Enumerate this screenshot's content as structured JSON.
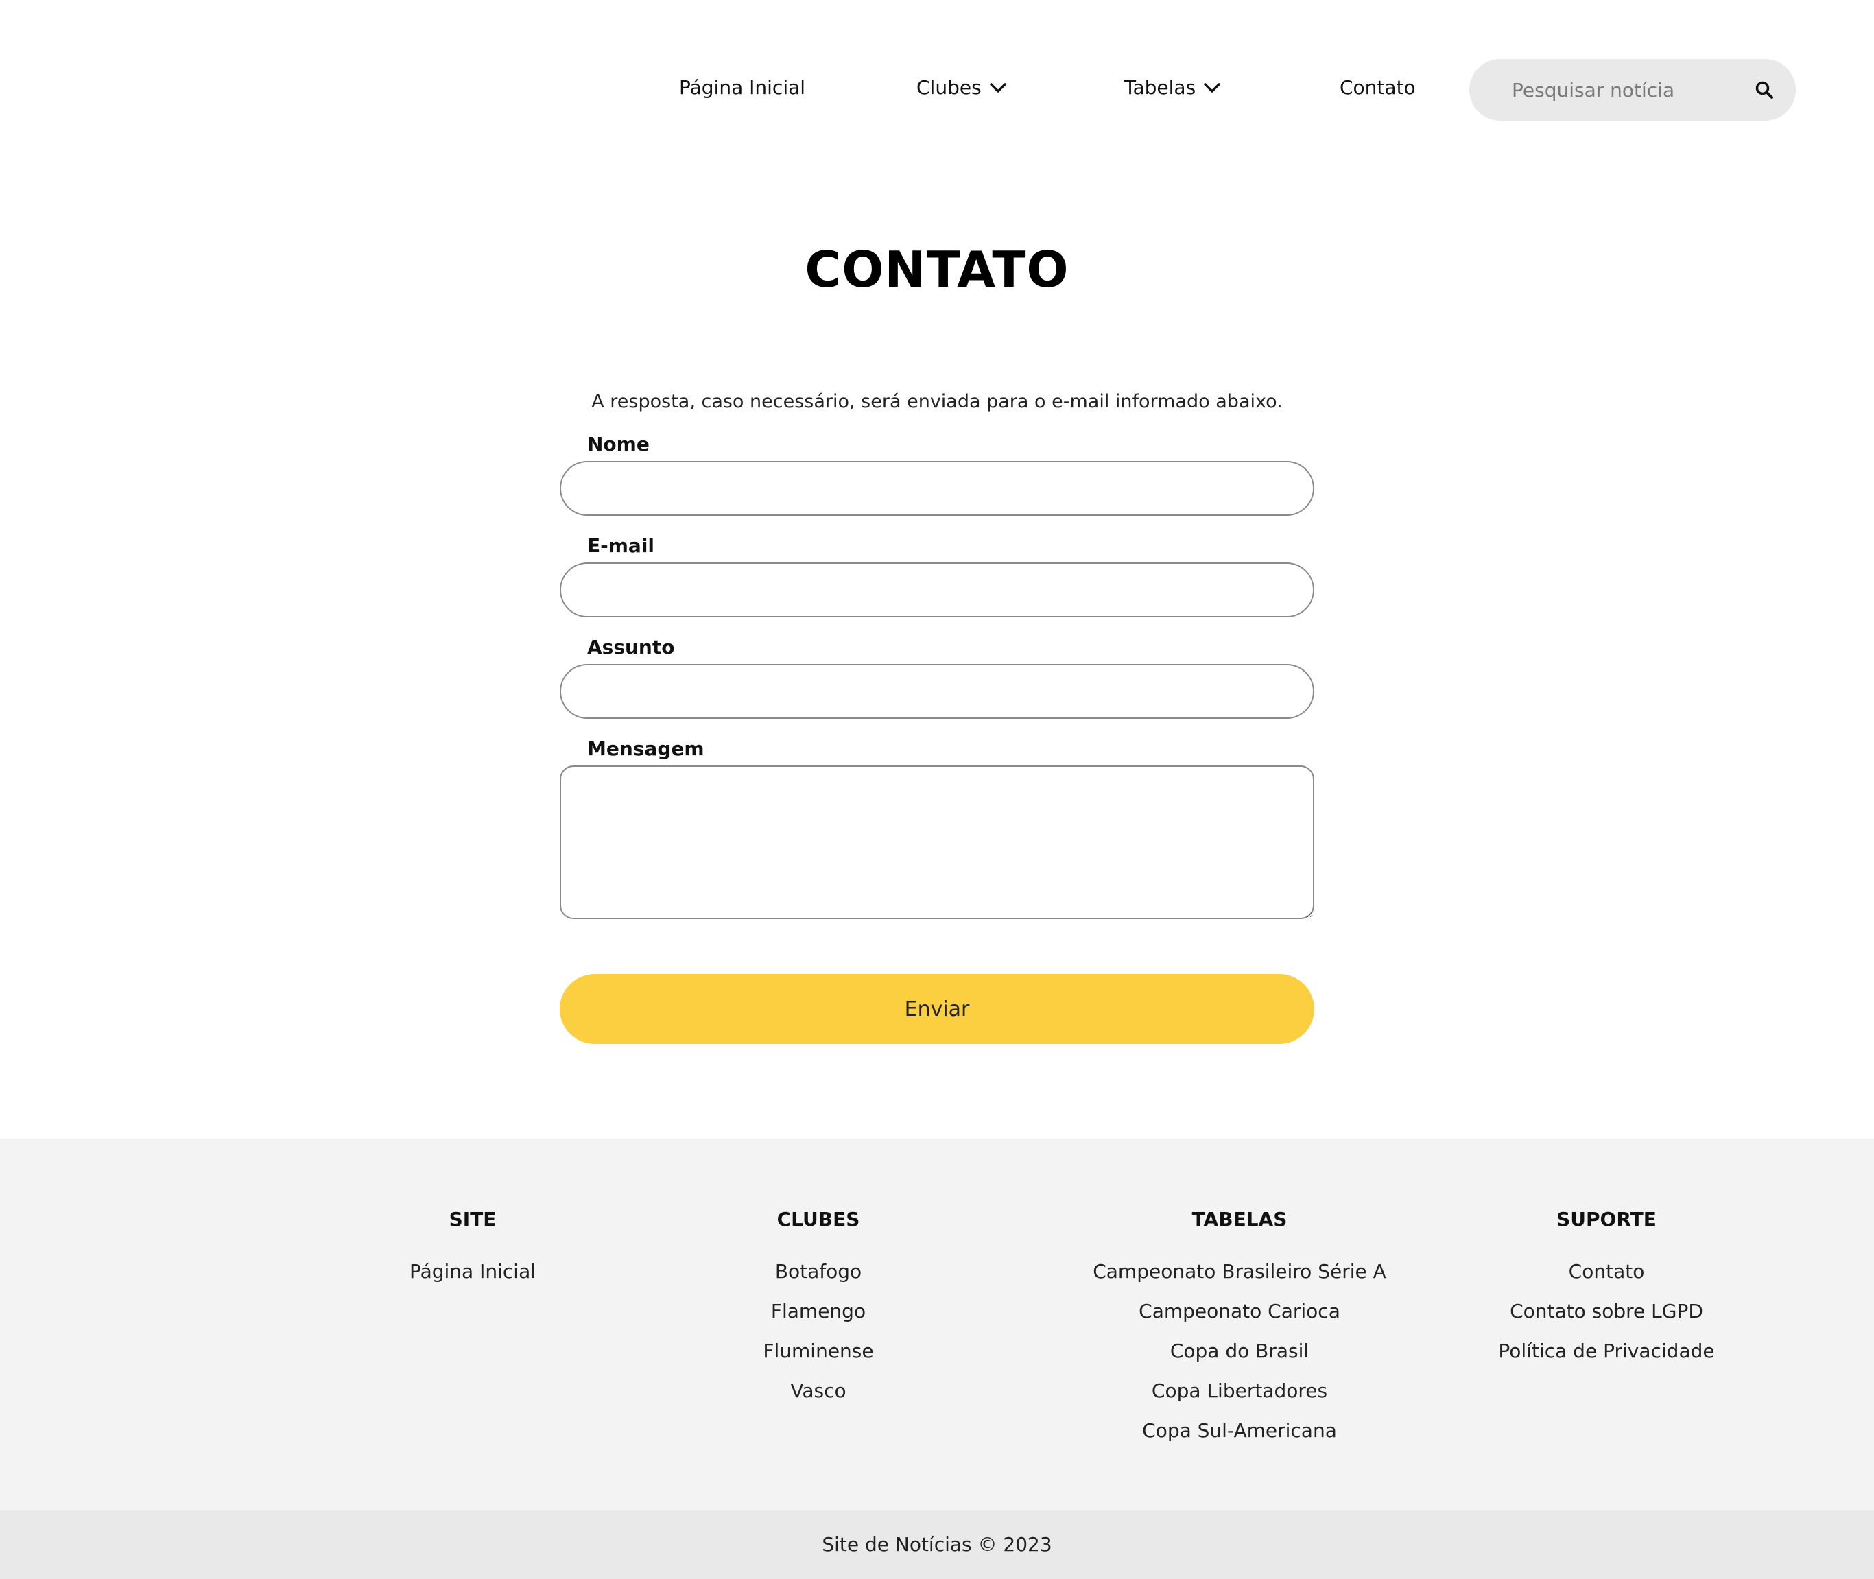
{
  "header": {
    "nav": {
      "home": "Página Inicial",
      "clubs": "Clubes",
      "tables": "Tabelas",
      "contact": "Contato"
    },
    "search": {
      "placeholder": "Pesquisar notícia",
      "icon": "search-icon"
    }
  },
  "main": {
    "title": "CONTATO",
    "intro": "A resposta, caso necessário, será enviada para o e-mail informado abaixo.",
    "form": {
      "name_label": "Nome",
      "email_label": "E-mail",
      "subject_label": "Assunto",
      "message_label": "Mensagem",
      "submit_label": "Enviar"
    }
  },
  "footer": {
    "site": {
      "heading": "SITE",
      "links": [
        "Página Inicial"
      ]
    },
    "clubs": {
      "heading": "CLUBES",
      "links": [
        "Botafogo",
        "Flamengo",
        "Fluminense",
        "Vasco"
      ]
    },
    "tables": {
      "heading": "TABELAS",
      "links": [
        "Campeonato Brasileiro Série A",
        "Campeonato Carioca",
        "Copa do Brasil",
        "Copa Libertadores",
        "Copa Sul-Americana"
      ]
    },
    "support": {
      "heading": "SUPORTE",
      "links": [
        "Contato",
        "Contato sobre LGPD",
        "Política de Privacidade"
      ]
    },
    "copyright": "Site de Notícias © 2023"
  },
  "colors": {
    "accent": "#fbcf40",
    "footer_bg": "#f3f3f3",
    "copyright_bg": "#e9e9e9",
    "search_bg": "#e9e9e9"
  }
}
